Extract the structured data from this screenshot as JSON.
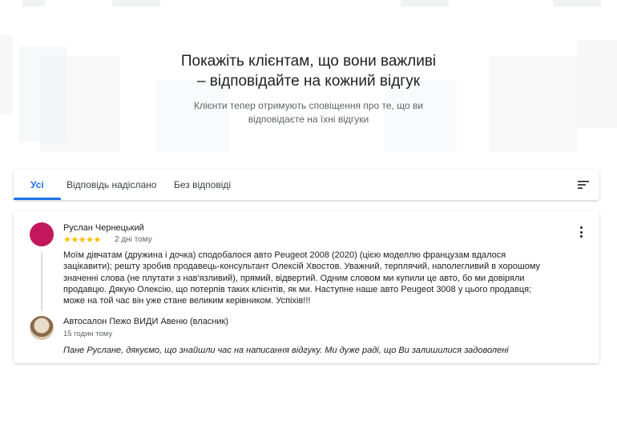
{
  "hero": {
    "title_line1": "Покажіть клієнтам, що вони важливі",
    "title_line2": "– відповідайте на кожний відгук",
    "subtitle_line1": "Клієнти тепер отримують сповіщення про те, що ви",
    "subtitle_line2": "відповідаєте на їхні відгуки"
  },
  "tabs": {
    "all": "Усі",
    "replied": "Відповідь надіслано",
    "unanswered": "Без відповіді",
    "active_index": 0,
    "filter_icon": "sort-icon"
  },
  "review": {
    "reviewer_name": "Руслан Чернецький",
    "rating": 5,
    "stars": "★★★★★",
    "date": "2 дні тому",
    "text": "Моїм дівчатам (дружина і дочка) сподобалося авто Peugeot 2008 (2020) (цією моделлю французам вдалося зацікавити); решту зробив продавець-консультант Олексій Хвостов. Уважний, терплячий, наполегливий в хорошому значенні слова (не плутати з нав'язливий), прямий, відвертий. Одним словом ми купили це авто, бо ми довіряли продавцю. Дякую Олексію, що потерпів таких клієнтів, як ми. Наступне наше авто Peugeot 3008 у цього продавця; може на той час він уже стане великим керівником. Успіхів!!!",
    "more_icon": "more-vert-icon"
  },
  "owner_reply": {
    "name": "Автосалон Пежо ВИДИ Авеню (власник)",
    "date": "15 годин тому",
    "text": "Пане Руслане, дякуємо, що знайшли час на написання відгуку. Ми дуже раді, що Ви залишилися задоволені"
  },
  "colors": {
    "accent": "#1a73e8",
    "star": "#fbbc04",
    "avatar": "#c2185b"
  }
}
